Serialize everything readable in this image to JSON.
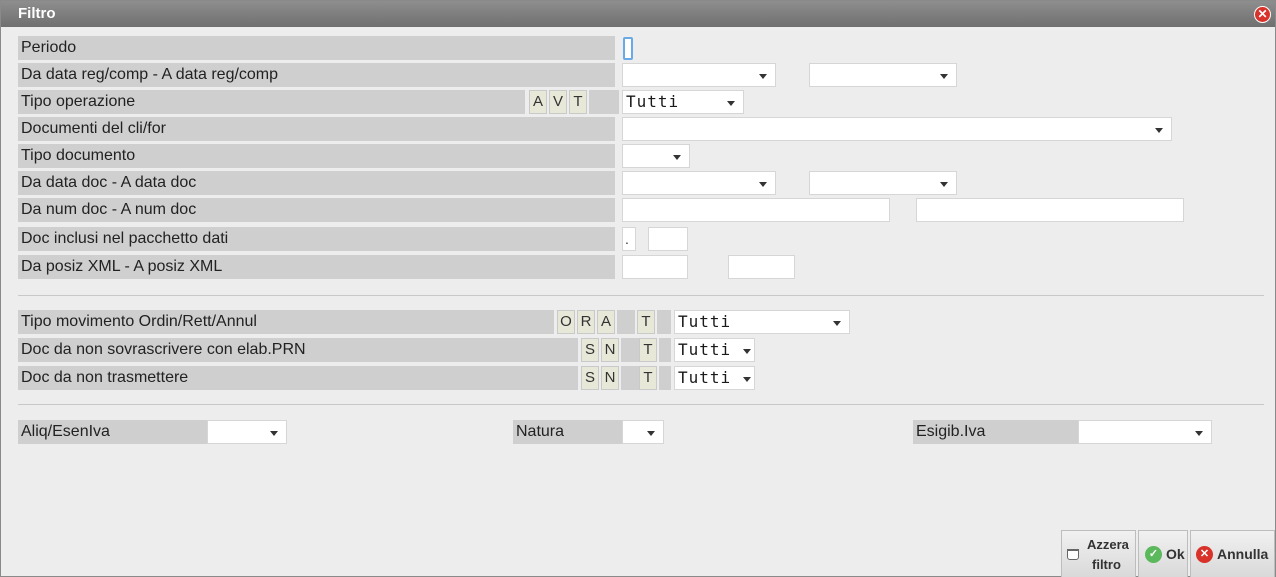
{
  "window": {
    "title": "Filtro"
  },
  "rows": {
    "periodo": "Periodo",
    "data_reg": "Da data reg/comp - A data reg/comp",
    "tipo_operazione": "Tipo operazione",
    "documenti_clifor": "Documenti del cli/for",
    "tipo_documento": "Tipo documento",
    "data_doc": "Da data doc - A data doc",
    "num_doc": "Da num doc - A num doc",
    "doc_inclusi": "Doc inclusi nel pacchetto dati",
    "posiz_xml": "Da posiz XML - A posiz XML",
    "tipo_movimento": "Tipo movimento Ordin/Rett/Annul",
    "doc_non_sovrascrivere": "Doc da non sovrascrivere con elab.PRN",
    "doc_non_trasmettere": "Doc da non trasmettere"
  },
  "codes": {
    "tipo_operazione": [
      "A",
      "V",
      "T"
    ],
    "tipo_movimento": [
      "O",
      "R",
      "A",
      "T"
    ],
    "sovrascrivere": [
      "S",
      "N",
      "T"
    ],
    "trasmettere": [
      "S",
      "N",
      "T"
    ]
  },
  "values": {
    "tipo_operazione": "Tutti",
    "tipo_movimento": "Tutti",
    "sovrascrivere": "Tutti",
    "trasmettere": "Tutti",
    "doc_inclusi_sep": "."
  },
  "bottom": {
    "aliq_label": "Aliq/EsenIva",
    "natura_label": "Natura",
    "esigib_label": "Esigib.Iva"
  },
  "buttons": {
    "azzera_line1": "Azzera",
    "azzera_line2": "filtro",
    "ok": "Ok",
    "annulla": "Annulla"
  },
  "colors": {
    "titlebar": "#7a7a7a",
    "close": "#d8322b",
    "ok_icon": "#5cb85c",
    "annulla_icon": "#d8322b"
  }
}
